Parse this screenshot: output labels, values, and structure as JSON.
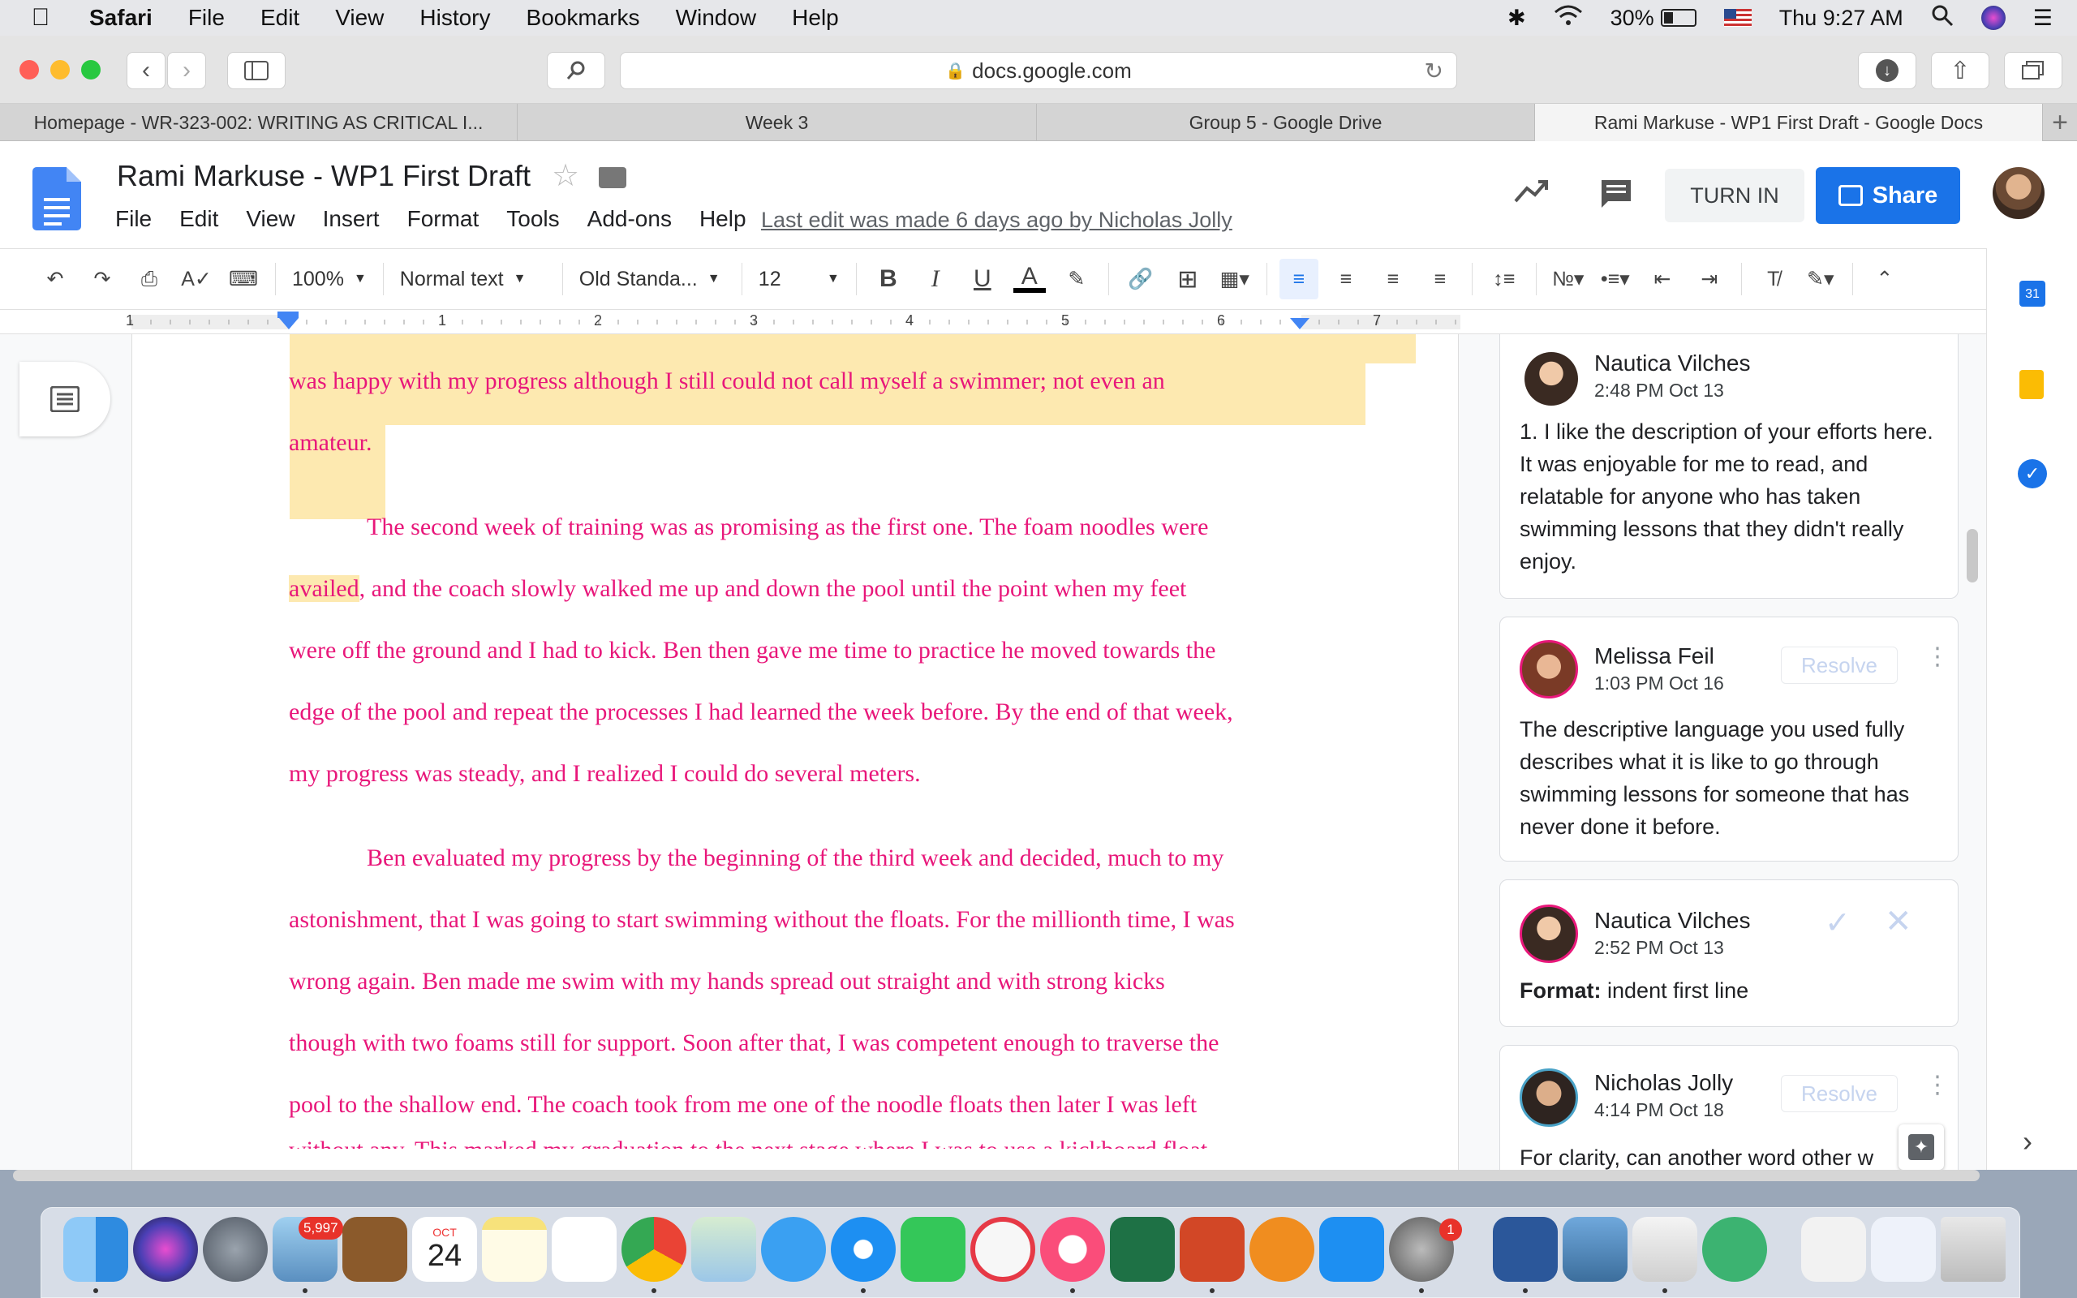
{
  "menubar": {
    "app": "Safari",
    "items": [
      "File",
      "Edit",
      "View",
      "History",
      "Bookmarks",
      "Window",
      "Help"
    ],
    "battery": "30%",
    "clock": "Thu 9:27 AM"
  },
  "safari": {
    "url": "docs.google.com",
    "tabs": [
      {
        "title": "Homepage - WR-323-002: WRITING AS CRITICAL I...",
        "active": false
      },
      {
        "title": "Week 3",
        "active": false
      },
      {
        "title": "Group 5 - Google Drive",
        "active": false
      },
      {
        "title": "Rami Markuse - WP1 First Draft - Google Docs",
        "active": true
      }
    ]
  },
  "docs": {
    "title": "Rami Markuse - WP1 First Draft",
    "menu": [
      "File",
      "Edit",
      "View",
      "Insert",
      "Format",
      "Tools",
      "Add-ons",
      "Help"
    ],
    "last_edit": "Last edit was made 6 days ago by Nicholas Jolly",
    "turn_in": "TURN IN",
    "share": "Share",
    "toolbar": {
      "zoom": "100%",
      "style": "Normal text",
      "font": "Old Standa...",
      "size": "12"
    },
    "ruler_marks": [
      "1",
      "1",
      "2",
      "3",
      "4",
      "5",
      "6",
      "7"
    ]
  },
  "body": {
    "lines": [
      "was happy with my progress although I still could not call myself a swimmer; not even an",
      "amateur.",
      "The second week of training was as promising as the first one. The foam noodles were",
      "availed, and the coach slowly walked me up and down the pool until the point when my feet",
      "were off the ground and I had to kick. Ben then gave me time to practice he moved towards the",
      "edge of the pool and repeat the processes I had learned the week before. By the end of that week,",
      "my progress was steady, and I realized I could do several meters.",
      "Ben evaluated my progress by the beginning of the third week and decided, much to my",
      "astonishment, that I was going to start swimming without the floats. For the millionth time, I was",
      "wrong again. Ben made me swim with my hands spread out straight and with strong kicks",
      "though with two foams still for support. Soon after that, I was competent enough to traverse the",
      "pool to the shallow end. The coach took from me one of the noodle floats then later I was left",
      "without any. This marked my graduation to the next stage where I was to use a kickboard float"
    ]
  },
  "comments": [
    {
      "author": "Nautica Vilches",
      "time": "2:48 PM Oct 13",
      "text": "1. I like the description of your efforts here. It was enjoyable for me to read, and relatable for anyone who has taken swimming lessons that they didn't really enjoy."
    },
    {
      "author": "Melissa Feil",
      "time": "1:03 PM Oct 16",
      "resolve": "Resolve",
      "text": "The descriptive language you used fully describes what it is like to go through swimming lessons for someone that has never done it before."
    },
    {
      "author": "Nautica Vilches",
      "time": "2:52 PM Oct 13",
      "format_label": "Format:",
      "format_value": "indent first line"
    },
    {
      "author": "Nicholas Jolly",
      "time": "4:14 PM Oct 18",
      "resolve": "Resolve",
      "text": "For clarity, can another word other w"
    }
  ],
  "dock": {
    "mail_badge": "5,997",
    "calendar_month": "OCT",
    "calendar_day": "24",
    "sysprefs_badge": "1"
  },
  "colors": {
    "doc_text": "#e8177a",
    "highlight": "#fde9b0",
    "share_blue": "#1a73e8"
  }
}
